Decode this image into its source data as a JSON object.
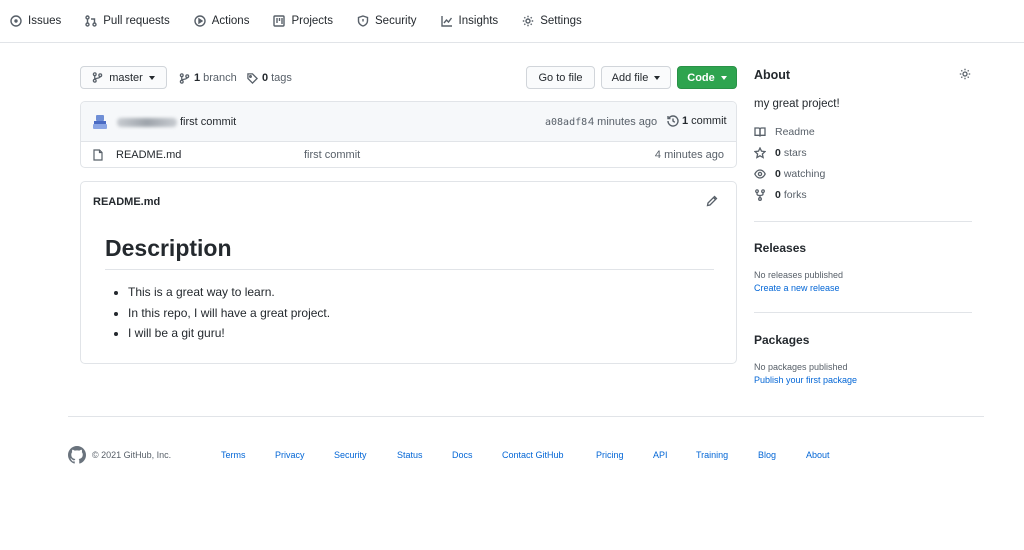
{
  "nav": {
    "items": [
      {
        "label": "Issues",
        "icon": "issue-icon"
      },
      {
        "label": "Pull requests",
        "icon": "pull-request-icon"
      },
      {
        "label": "Actions",
        "icon": "play-icon"
      },
      {
        "label": "Projects",
        "icon": "project-icon"
      },
      {
        "label": "Security",
        "icon": "shield-icon"
      },
      {
        "label": "Insights",
        "icon": "graph-icon"
      },
      {
        "label": "Settings",
        "icon": "gear-icon"
      }
    ]
  },
  "toolbar": {
    "branch_label": "master",
    "branch_count": "1",
    "branch_word": "branch",
    "tag_count": "0",
    "tag_word": "tags",
    "goto_label": "Go to file",
    "addfile_label": "Add file",
    "code_label": "Code"
  },
  "commit": {
    "message": "first commit",
    "sha": "a08adf8",
    "time": "4 minutes ago",
    "count": "1",
    "count_word": "commit"
  },
  "files": [
    {
      "name": "README.md",
      "commit": "first commit",
      "time": "4 minutes ago"
    }
  ],
  "readme": {
    "title": "README.md",
    "heading": "Description",
    "items": [
      "This is a great way to learn.",
      "In this repo, I will have a great project.",
      "I will be a git guru!"
    ]
  },
  "about": {
    "title": "About",
    "description": "my great project!",
    "readme_label": "Readme",
    "stars_count": "0",
    "stars_word": "stars",
    "watching_count": "0",
    "watching_word": "watching",
    "forks_count": "0",
    "forks_word": "forks"
  },
  "releases": {
    "title": "Releases",
    "empty": "No releases published",
    "link": "Create a new release"
  },
  "packages": {
    "title": "Packages",
    "empty": "No packages published",
    "link": "Publish your first package"
  },
  "footer": {
    "copyright": "© 2021 GitHub, Inc.",
    "links": [
      "Terms",
      "Privacy",
      "Security",
      "Status",
      "Docs",
      "Contact GitHub",
      "Pricing",
      "API",
      "Training",
      "Blog",
      "About"
    ]
  },
  "colors": {
    "code_button": "#2ea44f",
    "link": "#0366d6",
    "border": "#e1e4e8",
    "muted": "#586069"
  }
}
